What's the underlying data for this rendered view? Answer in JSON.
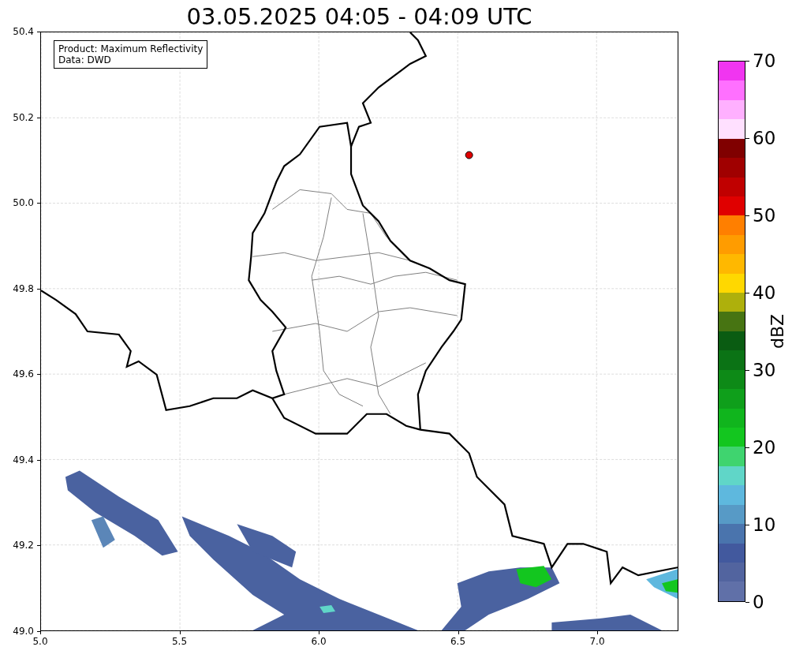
{
  "title": "03.05.2025 04:05 - 04:09 UTC",
  "legend": [
    "Product: Maximum Reflectivity",
    "Data: DWD"
  ],
  "axes": {
    "xticks": [
      "5.0",
      "5.5",
      "6.0",
      "6.5",
      "7.0"
    ],
    "yticks": [
      "50.4",
      "50.2",
      "50.0",
      "49.8",
      "49.6",
      "49.4",
      "49.2",
      "49.0"
    ]
  },
  "colorbar": {
    "label": "dBZ",
    "ticks": [
      "70",
      "60",
      "50",
      "40",
      "30",
      "20",
      "10",
      "0"
    ],
    "segments": [
      {
        "color": "#f035f0"
      },
      {
        "color": "#ff70ff"
      },
      {
        "color": "#ffb0ff"
      },
      {
        "color": "#ffe0ff"
      },
      {
        "color": "#800000"
      },
      {
        "color": "#a00000"
      },
      {
        "color": "#c00000"
      },
      {
        "color": "#e00000"
      },
      {
        "color": "#ff7f00"
      },
      {
        "color": "#ff9c00"
      },
      {
        "color": "#ffb800"
      },
      {
        "color": "#ffd800"
      },
      {
        "color": "#aeb00c"
      },
      {
        "color": "#477412"
      },
      {
        "color": "#0a5c12"
      },
      {
        "color": "#0b7315"
      },
      {
        "color": "#0d8a17"
      },
      {
        "color": "#0f9f1b"
      },
      {
        "color": "#10b51d"
      },
      {
        "color": "#13c61f"
      },
      {
        "color": "#3fd46f"
      },
      {
        "color": "#60d6c8"
      },
      {
        "color": "#5eb8de"
      },
      {
        "color": "#579ac6"
      },
      {
        "color": "#4a74ad"
      },
      {
        "color": "#42599e"
      },
      {
        "color": "#52649f"
      },
      {
        "color": "#6070a8"
      }
    ]
  }
}
